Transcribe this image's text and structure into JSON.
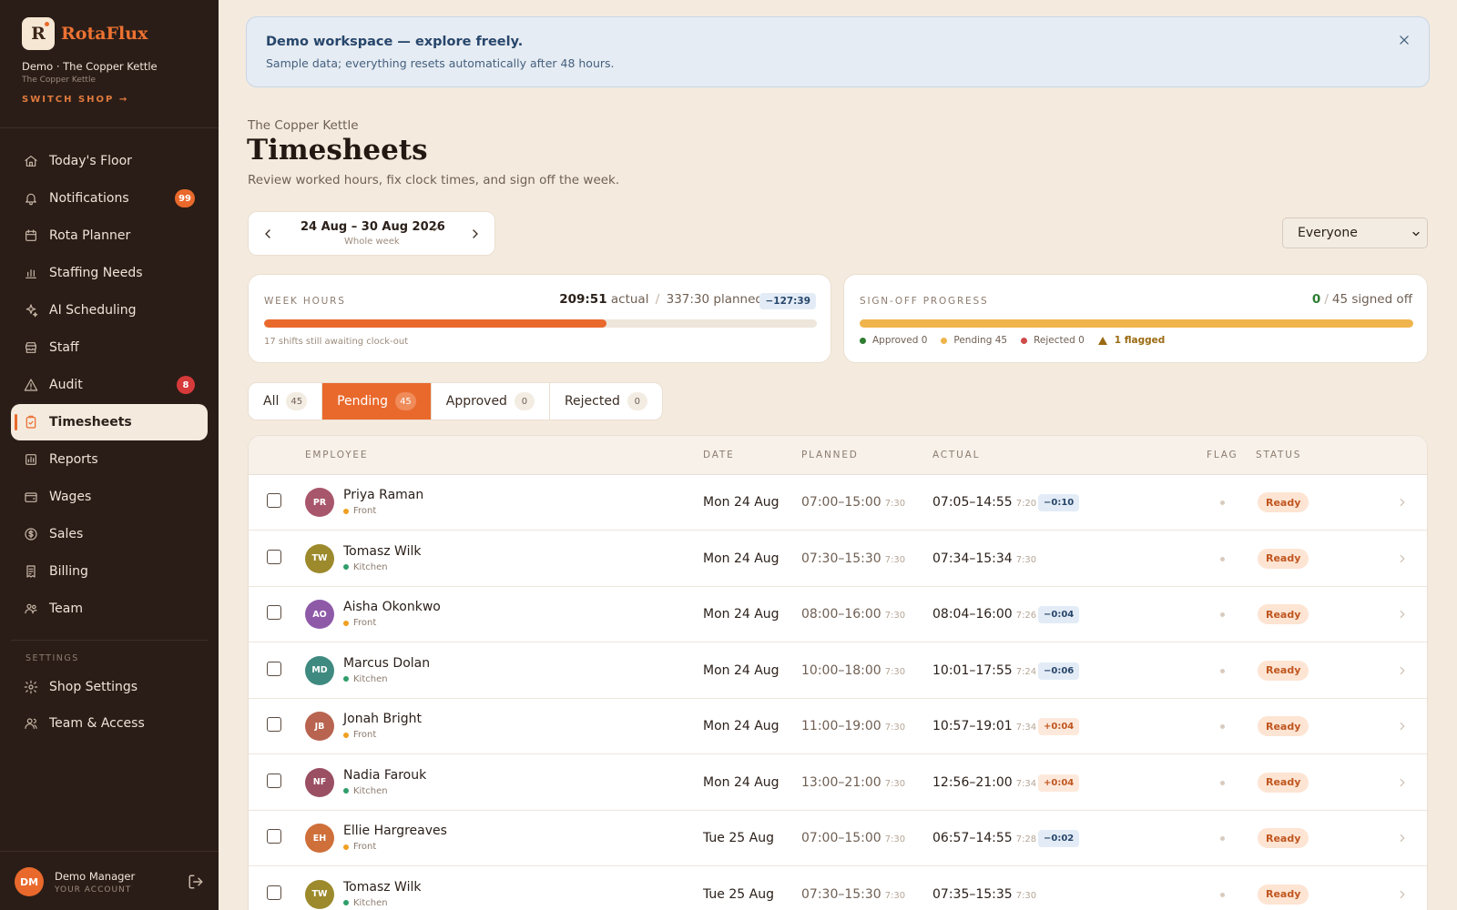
{
  "brand": {
    "logo_letter": "R",
    "name": "RotaFlux"
  },
  "shop": {
    "line": "Demo · The Copper Kettle",
    "sub": "The Copper Kettle",
    "switch": "SWITCH SHOP →"
  },
  "nav": [
    {
      "label": "Today's Floor",
      "icon": "home-icon"
    },
    {
      "label": "Notifications",
      "icon": "bell-icon",
      "badge": "99",
      "badge_color": "orange"
    },
    {
      "label": "Rota Planner",
      "icon": "calendar-icon"
    },
    {
      "label": "Staffing Needs",
      "icon": "bar-chart-icon"
    },
    {
      "label": "AI Scheduling",
      "icon": "sparkle-icon"
    },
    {
      "label": "Staff",
      "icon": "shop-icon"
    },
    {
      "label": "Audit",
      "icon": "warning-icon",
      "badge": "8",
      "badge_color": "red"
    },
    {
      "label": "Timesheets",
      "icon": "clipboard-check-icon",
      "active": true
    },
    {
      "label": "Reports",
      "icon": "reports-icon"
    },
    {
      "label": "Wages",
      "icon": "wallet-icon"
    },
    {
      "label": "Sales",
      "icon": "dollar-circle-icon"
    },
    {
      "label": "Billing",
      "icon": "receipt-icon"
    },
    {
      "label": "Team",
      "icon": "team-icon"
    }
  ],
  "settings": {
    "label": "SETTINGS",
    "items": [
      {
        "label": "Shop Settings",
        "icon": "gear-icon"
      },
      {
        "label": "Team & Access",
        "icon": "users-icon"
      }
    ]
  },
  "account": {
    "initials": "DM",
    "name": "Demo Manager",
    "sub": "YOUR ACCOUNT"
  },
  "banner": {
    "title": "Demo workspace — explore freely.",
    "text": "Sample data; everything resets automatically after 48 hours."
  },
  "page": {
    "crumb": "The Copper Kettle",
    "title": "Timesheets",
    "subtitle": "Review worked hours, fix clock times, and sign off the week."
  },
  "week": {
    "range": "24 Aug – 30 Aug 2026",
    "sub": "Whole week"
  },
  "filter": {
    "value": "Everyone"
  },
  "week_hours": {
    "label": "WEEK HOURS",
    "actual": "209:51",
    "actual_label": "actual",
    "sep": "/",
    "planned": "337:30 planned",
    "diff": "−127:39",
    "progress": 0.62,
    "note": "17 shifts still awaiting clock-out"
  },
  "signoff": {
    "label": "SIGN-OFF PROGRESS",
    "signed": "0",
    "sep": "/",
    "total_label": "45 signed off",
    "progress": 1.0,
    "bar_color": "#f0b44c",
    "legend": [
      {
        "label": "Approved 0",
        "color": "#2e7d32"
      },
      {
        "label": "Pending 45",
        "color": "#f0b44c"
      },
      {
        "label": "Rejected 0",
        "color": "#d14a4a"
      }
    ],
    "flagged": "1 flagged"
  },
  "tabs": [
    {
      "label": "All",
      "count": "45"
    },
    {
      "label": "Pending",
      "count": "45",
      "active": true
    },
    {
      "label": "Approved",
      "count": "0"
    },
    {
      "label": "Rejected",
      "count": "0"
    }
  ],
  "table": {
    "headers": {
      "employee": "EMPLOYEE",
      "date": "DATE",
      "planned": "PLANNED",
      "actual": "ACTUAL",
      "flag": "FLAG",
      "status": "STATUS"
    },
    "rows": [
      {
        "initials": "PR",
        "avatar_color": "#a8566b",
        "name": "Priya Raman",
        "dept": "Front",
        "dept_color": "#f0a020",
        "date": "Mon 24 Aug",
        "planned": "07:00–15:00",
        "planned_dur": "7:30",
        "actual": "07:05–14:55",
        "actual_dur": "7:20",
        "delta": "−0:10",
        "delta_type": "neg",
        "status": "Ready"
      },
      {
        "initials": "TW",
        "avatar_color": "#9c8a2c",
        "name": "Tomasz Wilk",
        "dept": "Kitchen",
        "dept_color": "#2f9e6a",
        "date": "Mon 24 Aug",
        "planned": "07:30–15:30",
        "planned_dur": "7:30",
        "actual": "07:34–15:34",
        "actual_dur": "7:30",
        "delta": "",
        "delta_type": "none",
        "status": "Ready"
      },
      {
        "initials": "AO",
        "avatar_color": "#8e5aa8",
        "name": "Aisha Okonkwo",
        "dept": "Front",
        "dept_color": "#f0a020",
        "date": "Mon 24 Aug",
        "planned": "08:00–16:00",
        "planned_dur": "7:30",
        "actual": "08:04–16:00",
        "actual_dur": "7:26",
        "delta": "−0:04",
        "delta_type": "neg",
        "status": "Ready"
      },
      {
        "initials": "MD",
        "avatar_color": "#3f8a80",
        "name": "Marcus Dolan",
        "dept": "Kitchen",
        "dept_color": "#2f9e6a",
        "date": "Mon 24 Aug",
        "planned": "10:00–18:00",
        "planned_dur": "7:30",
        "actual": "10:01–17:55",
        "actual_dur": "7:24",
        "delta": "−0:06",
        "delta_type": "neg",
        "status": "Ready"
      },
      {
        "initials": "JB",
        "avatar_color": "#b86450",
        "name": "Jonah Bright",
        "dept": "Front",
        "dept_color": "#f0a020",
        "date": "Mon 24 Aug",
        "planned": "11:00–19:00",
        "planned_dur": "7:30",
        "actual": "10:57–19:01",
        "actual_dur": "7:34",
        "delta": "+0:04",
        "delta_type": "pos",
        "status": "Ready"
      },
      {
        "initials": "NF",
        "avatar_color": "#9a4f63",
        "name": "Nadia Farouk",
        "dept": "Kitchen",
        "dept_color": "#2f9e6a",
        "date": "Mon 24 Aug",
        "planned": "13:00–21:00",
        "planned_dur": "7:30",
        "actual": "12:56–21:00",
        "actual_dur": "7:34",
        "delta": "+0:04",
        "delta_type": "pos",
        "status": "Ready"
      },
      {
        "initials": "EH",
        "avatar_color": "#cf6f3a",
        "name": "Ellie Hargreaves",
        "dept": "Front",
        "dept_color": "#f0a020",
        "date": "Tue 25 Aug",
        "planned": "07:00–15:00",
        "planned_dur": "7:30",
        "actual": "06:57–14:55",
        "actual_dur": "7:28",
        "delta": "−0:02",
        "delta_type": "neg",
        "status": "Ready"
      },
      {
        "initials": "TW",
        "avatar_color": "#9c8a2c",
        "name": "Tomasz Wilk",
        "dept": "Kitchen",
        "dept_color": "#2f9e6a",
        "date": "Tue 25 Aug",
        "planned": "07:30–15:30",
        "planned_dur": "7:30",
        "actual": "07:35–15:35",
        "actual_dur": "7:30",
        "delta": "",
        "delta_type": "none",
        "status": "Ready"
      }
    ]
  }
}
